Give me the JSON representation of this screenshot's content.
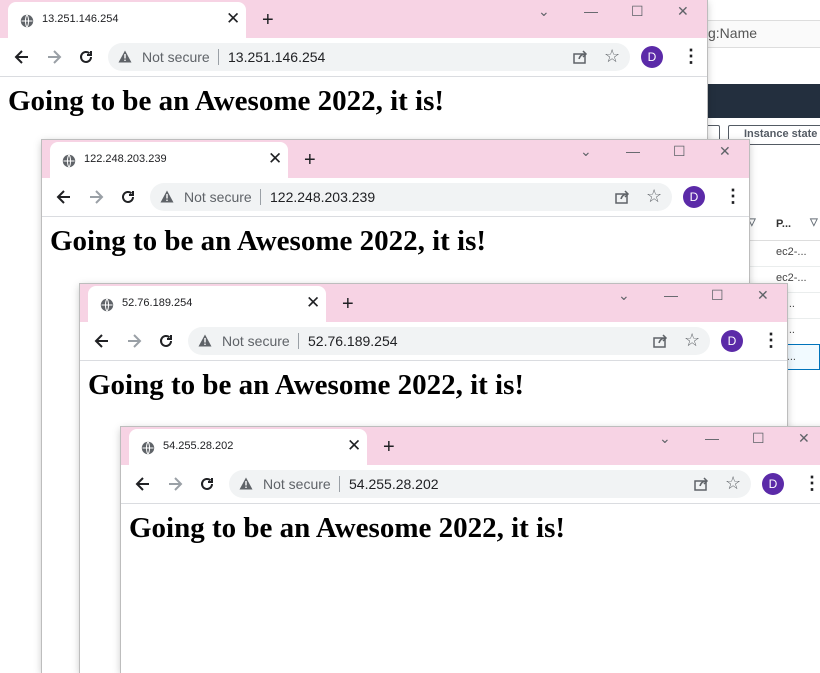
{
  "background_app": {
    "tag_label": "g:Name",
    "instance_state_button": "Instance state",
    "column_header": "P...",
    "rows": [
      "ec2-...",
      "ec2-...",
      "2-...",
      "2-...",
      "2-..."
    ]
  },
  "windows": [
    {
      "tab_title": "13.251.146.254",
      "security_label": "Not secure",
      "url": "13.251.146.254",
      "heading": "Going to be an Awesome 2022, it is!",
      "avatar_letter": "D"
    },
    {
      "tab_title": "122.248.203.239",
      "security_label": "Not secure",
      "url": "122.248.203.239",
      "heading": "Going to be an Awesome 2022, it is!",
      "avatar_letter": "D"
    },
    {
      "tab_title": "52.76.189.254",
      "security_label": "Not secure",
      "url": "52.76.189.254",
      "heading": "Going to be an Awesome 2022, it is!",
      "avatar_letter": "D"
    },
    {
      "tab_title": "54.255.28.202",
      "security_label": "Not secure",
      "url": "54.255.28.202",
      "heading": "Going to be an Awesome 2022, it is!",
      "avatar_letter": "D"
    }
  ],
  "icons": {
    "tab_favicon": "globe-icon",
    "tab_close": "close-icon",
    "new_tab": "plus-icon",
    "back": "arrow-left-icon",
    "forward": "arrow-right-icon",
    "reload": "reload-icon",
    "security": "warning-triangle-icon",
    "share": "share-icon",
    "bookmark": "star-icon",
    "menu": "kebab-menu-icon",
    "minimize": "minimize-icon",
    "maximize": "maximize-icon",
    "close_window": "close-window-icon",
    "tab_search": "chevron-down-icon"
  },
  "colors": {
    "titlebar": "#f7d3e4",
    "omnibox": "#f1f3f4",
    "avatar": "#5b2aa8",
    "aws_nav": "#232f3e"
  }
}
